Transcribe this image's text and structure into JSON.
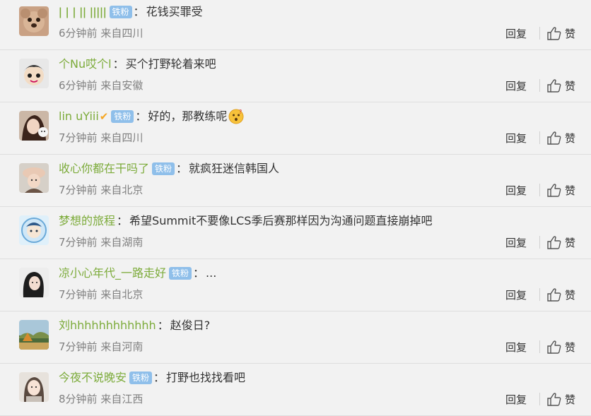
{
  "comments": [
    {
      "username": "ǀ ǀ ǀ ǀǀ ǀǀǀǀǀ",
      "badge": "铁粉",
      "separator": "：",
      "text": "花钱买罪受",
      "time": "6分钟前",
      "location": "来自四川",
      "avatar": "dog"
    },
    {
      "username": "个Nu哎个l",
      "badge": "",
      "separator": "：",
      "text": "买个打野轮着来吧",
      "time": "6分钟前",
      "location": "来自安徽",
      "avatar": "cartoon"
    },
    {
      "username": "lin uYiii",
      "badge": "铁粉",
      "separator": "：",
      "text": "好的，那教练呢",
      "time": "7分钟前",
      "location": "来自四川",
      "avatar": "girl-cat",
      "emoji": "think-emoji"
    },
    {
      "username": "收心你都在干吗了",
      "badge": "铁粉",
      "separator": "：",
      "text": "就疯狂迷信韩国人",
      "time": "7分钟前",
      "location": "来自北京",
      "avatar": "girl-hat"
    },
    {
      "username": "梦想的旅程",
      "badge": "",
      "separator": "：",
      "text": "希望Summit不要像LCS季后赛那样因为沟通问题直接崩掉吧",
      "time": "7分钟前",
      "location": "来自湖南",
      "avatar": "cartoon-blue"
    },
    {
      "username": "凉小心年代_一路走好",
      "badge": "铁粉",
      "separator": "：",
      "text": "...",
      "time": "7分钟前",
      "location": "来自北京",
      "avatar": "girl-dark"
    },
    {
      "username": "刘hhhhhhhhhhhh",
      "badge": "",
      "separator": "：",
      "text": "赵俊日?",
      "time": "7分钟前",
      "location": "来自河南",
      "avatar": "landscape"
    },
    {
      "username": "今夜不说晚安",
      "badge": "铁粉",
      "separator": "：",
      "text": "打野也找找看吧",
      "time": "8分钟前",
      "location": "来自江西",
      "avatar": "girl-light"
    }
  ],
  "actions": {
    "reply": "回复",
    "like": "赞"
  },
  "colors": {
    "username": "#7cab3a",
    "badge": "#8fbfea",
    "meta": "#808080",
    "background": "#f2f2f2"
  }
}
